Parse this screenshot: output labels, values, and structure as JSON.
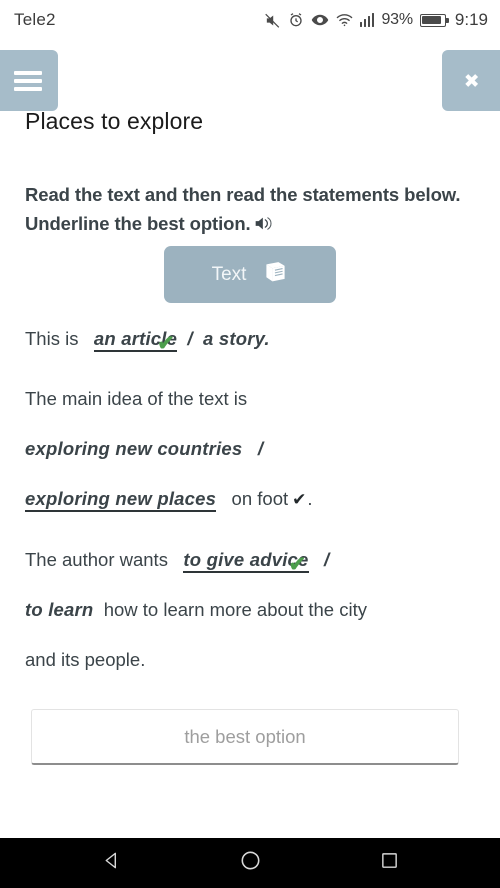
{
  "status_bar": {
    "carrier": "Tele2",
    "battery_percent": "93%",
    "clock": "9:19",
    "icons": [
      "mute-icon",
      "alarm-icon",
      "eye-care-icon",
      "wifi-icon",
      "signal-bars-icon",
      "battery-icon"
    ]
  },
  "header": {
    "menu_icon": "hamburger-menu-icon",
    "close_icon": "close-x-icon",
    "title": "Places to explore"
  },
  "instruction": {
    "text": "Read the text and then read the statements below. Underline the best option.",
    "audio_icon": "speaker-icon"
  },
  "text_button": {
    "label": "Text",
    "icon": "book-icon"
  },
  "exercise": {
    "statements": [
      {
        "id": "statement-1",
        "lines": [
          {
            "parts": [
              {
                "type": "plain",
                "text": "This is "
              },
              {
                "type": "option",
                "text": "an article",
                "chosen": true,
                "tick": "green"
              },
              {
                "type": "plain",
                "text": " / "
              },
              {
                "type": "option",
                "text": "a story.",
                "chosen": false,
                "tick": "none"
              }
            ]
          }
        ]
      },
      {
        "id": "statement-2",
        "lines": [
          {
            "parts": [
              {
                "type": "plain",
                "text": "The main idea of the text is"
              }
            ]
          },
          {
            "parts": [
              {
                "type": "option",
                "text": "exploring new countries",
                "chosen": false,
                "tick": "none"
              },
              {
                "type": "plain",
                "text": " / "
              }
            ]
          },
          {
            "parts": [
              {
                "type": "option",
                "text": "exploring new places",
                "chosen": true,
                "tick": "none"
              },
              {
                "type": "plain",
                "text": " on foot"
              },
              {
                "type": "tick",
                "text": "✔",
                "tick": "dark"
              },
              {
                "type": "plain",
                "text": " ."
              }
            ]
          }
        ]
      },
      {
        "id": "statement-3",
        "lines": [
          {
            "parts": [
              {
                "type": "plain",
                "text": "The author wants "
              },
              {
                "type": "option",
                "text": "to give advice",
                "chosen": true,
                "tick": "green"
              },
              {
                "type": "plain",
                "text": " / "
              }
            ]
          },
          {
            "parts": [
              {
                "type": "option",
                "text": "to learn",
                "chosen": false,
                "tick": "none"
              },
              {
                "type": "plain",
                "text": " how to learn more about the city"
              }
            ]
          },
          {
            "parts": [
              {
                "type": "plain",
                "text": "and its people."
              }
            ]
          }
        ]
      }
    ],
    "line_1": "This is",
    "line_1_opt_a": "an article",
    "line_1_sep": "/",
    "line_1_opt_b": "a story.",
    "line_2": "The main idea of the text is",
    "line_3_opt_a": "exploring new countries",
    "line_3_sep": "/",
    "line_4_opt_b": "exploring new places",
    "line_4_tail": "on foot",
    "line_4_end": ".",
    "line_5": "The author wants",
    "line_5_opt_a": "to give advice",
    "line_5_sep": "/",
    "line_6_opt_b": "to learn",
    "line_6_tail": "how to learn more about the city",
    "line_7": "and its people."
  },
  "answer_field": {
    "value": "",
    "placeholder": "the best option"
  },
  "nav_bar": {
    "back_icon": "back-triangle-icon",
    "home_icon": "home-circle-icon",
    "recents_icon": "recents-square-icon"
  },
  "colors": {
    "accent": "#a6bcc9",
    "button": "#9cb2bf",
    "text": "#3b4449",
    "tick_green": "#4c9e4c",
    "nav_bar": "#000000"
  }
}
